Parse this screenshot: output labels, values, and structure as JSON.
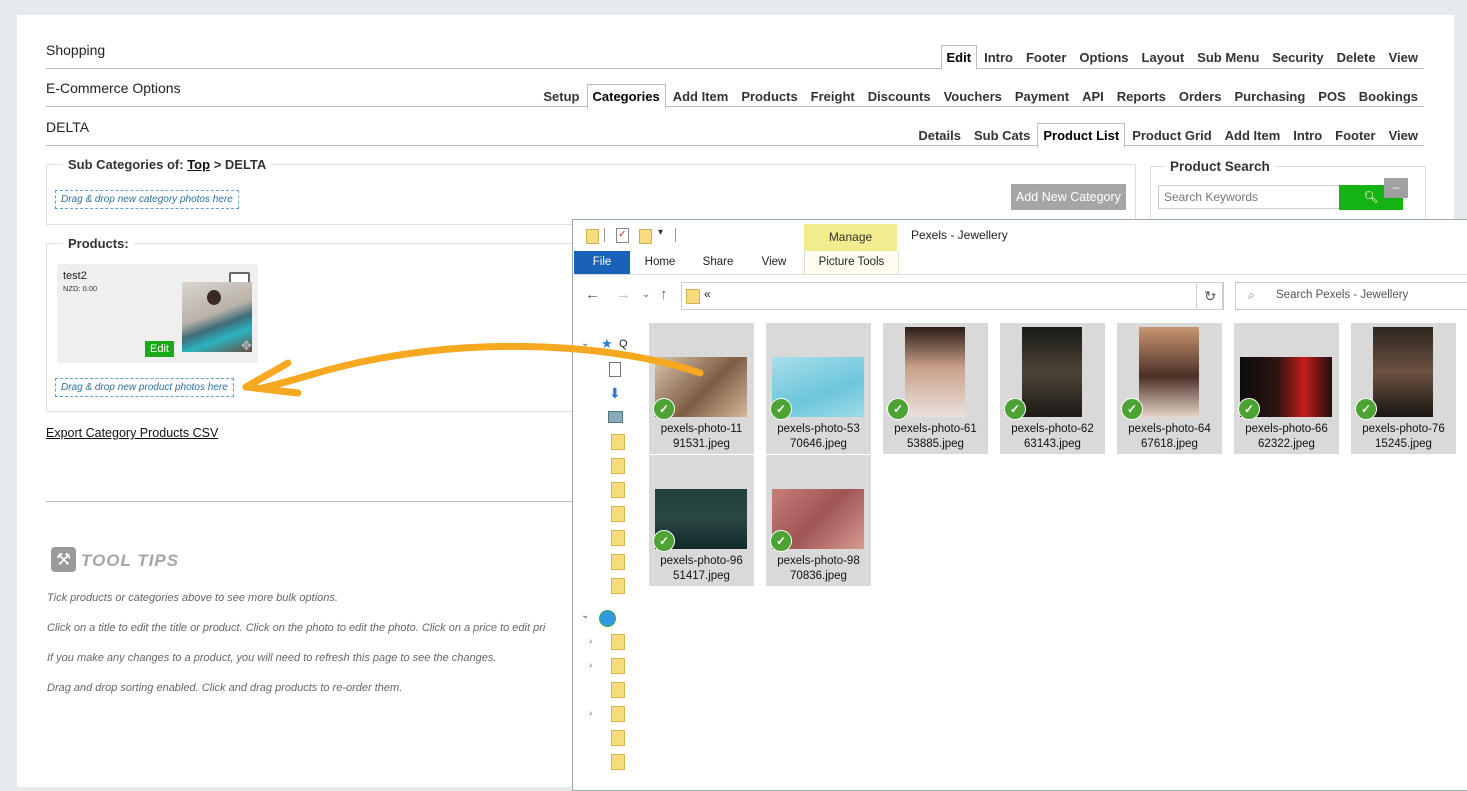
{
  "sections": {
    "shopping": "Shopping",
    "ecommerce": "E-Commerce Options",
    "delta": "DELTA"
  },
  "tabs_row1": [
    "Edit",
    "Intro",
    "Footer",
    "Options",
    "Layout",
    "Sub Menu",
    "Security",
    "Delete",
    "View"
  ],
  "tabs_row2": [
    "Setup",
    "Categories",
    "Add Item",
    "Products",
    "Freight",
    "Discounts",
    "Vouchers",
    "Payment",
    "API",
    "Reports",
    "Orders",
    "Purchasing",
    "POS",
    "Bookings"
  ],
  "tabs_row3": [
    "Details",
    "Sub Cats",
    "Product List",
    "Product Grid",
    "Add Item",
    "Intro",
    "Footer",
    "View"
  ],
  "subcats": {
    "legend_prefix": "Sub Categories of:",
    "top_link": "Top",
    "legend_suffix": "> DELTA",
    "dropzone": "Drag & drop new category photos here",
    "add_button": "Add New Category"
  },
  "product_search": {
    "legend": "Product Search",
    "placeholder": "Search Keywords",
    "minimize": "–"
  },
  "products": {
    "legend": "Products:",
    "card": {
      "name": "test2",
      "price": "NZD: 0.00",
      "edit": "Edit"
    },
    "dropzone": "Drag & drop new product photos here"
  },
  "export_link": "Export Category Products CSV",
  "tooltips": {
    "heading": "TOOL TIPS",
    "lines": [
      "Tick products or categories above to see more bulk options.",
      "Click on a title to edit the title or product. Click on the photo to edit the photo. Click on a price to edit pri",
      "If you make any changes to a product, you will need to refresh this page to see the changes.",
      "Drag and drop sorting enabled. Click and drag products to re-order them."
    ]
  },
  "explorer": {
    "manage": "Manage",
    "title": "Pexels - Jewellery",
    "tabs": [
      "File",
      "Home",
      "Share",
      "View",
      "Picture Tools"
    ],
    "address": "«",
    "search_placeholder": "Search Pexels - Jewellery",
    "files": [
      {
        "line1": "pexels-photo-11",
        "line2": "91531.jpeg"
      },
      {
        "line1": "pexels-photo-53",
        "line2": "70646.jpeg"
      },
      {
        "line1": "pexels-photo-61",
        "line2": "53885.jpeg"
      },
      {
        "line1": "pexels-photo-62",
        "line2": "63143.jpeg"
      },
      {
        "line1": "pexels-photo-64",
        "line2": "67618.jpeg"
      },
      {
        "line1": "pexels-photo-66",
        "line2": "62322.jpeg"
      },
      {
        "line1": "pexels-photo-76",
        "line2": "15245.jpeg"
      },
      {
        "line1": "pexels-photo-96",
        "line2": "51417.jpeg"
      },
      {
        "line1": "pexels-photo-98",
        "line2": "70836.jpeg"
      }
    ]
  },
  "colors": {
    "arrow": "#f6a920",
    "edit_green": "#1aa81a",
    "search_green": "#12b312",
    "file_blue": "#1a62b7",
    "manage_yellow": "#f2ec8f"
  }
}
